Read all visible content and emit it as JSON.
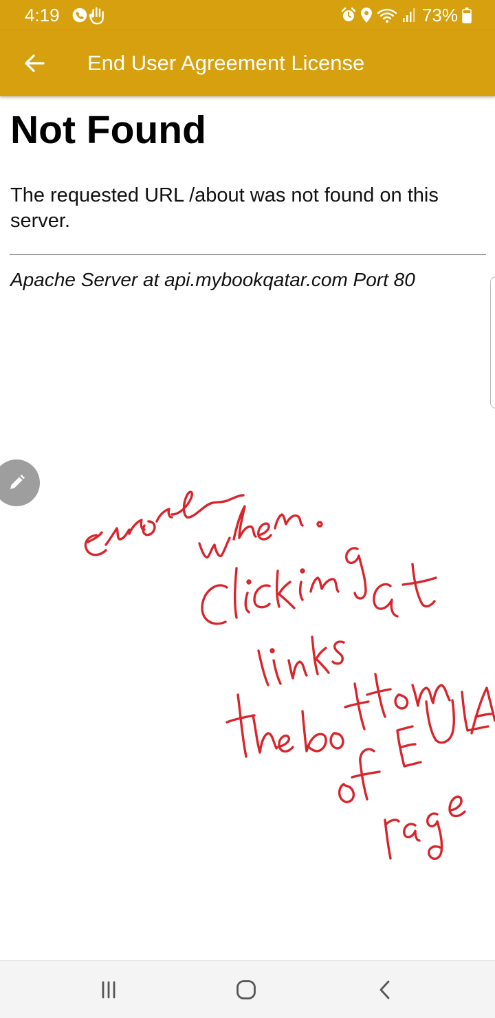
{
  "status_bar": {
    "time": "4:19",
    "battery_percent": "73%",
    "icons": [
      "call-icon",
      "hand-icon",
      "alarm-icon",
      "location-icon",
      "wifi-icon",
      "signal-icon",
      "battery-icon"
    ]
  },
  "app_bar": {
    "title": "End User Agreement License",
    "background_color": "#d6a00f",
    "back_icon": "arrow-left-icon"
  },
  "page": {
    "heading": "Not Found",
    "message": "The requested URL /about was not found on this server.",
    "footer": "Apache Server at api.mybookqatar.com Port 80"
  },
  "annotation": {
    "handwritten_text": "error when clicking links at the bottom of EULA page",
    "ink_color": "#d8252c"
  },
  "nav_bar": {
    "icons": [
      "recents-icon",
      "home-icon",
      "back-icon"
    ]
  }
}
